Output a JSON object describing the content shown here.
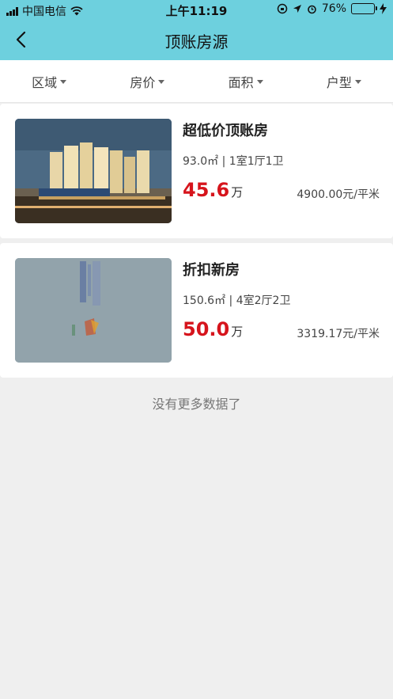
{
  "status": {
    "carrier": "中国电信",
    "time": "上午11:19",
    "battery": "76%",
    "battery_level": 0.76
  },
  "nav": {
    "title": "顶账房源"
  },
  "filters": [
    {
      "label": "区域"
    },
    {
      "label": "房价"
    },
    {
      "label": "面积"
    },
    {
      "label": "户型"
    }
  ],
  "listings": [
    {
      "title": "超低价顶账房",
      "area": "93.0㎡",
      "layout": "1室1厅1卫",
      "price": "45.6",
      "price_unit": "万",
      "unit_price": "4900.00元/平米"
    },
    {
      "title": "折扣新房",
      "area": "150.6㎡",
      "layout": "4室2厅2卫",
      "price": "50.0",
      "price_unit": "万",
      "unit_price": "3319.17元/平米"
    }
  ],
  "footer": {
    "no_more": "没有更多数据了"
  },
  "colors": {
    "header_bg": "#6dd0de",
    "price": "#d6141c"
  }
}
